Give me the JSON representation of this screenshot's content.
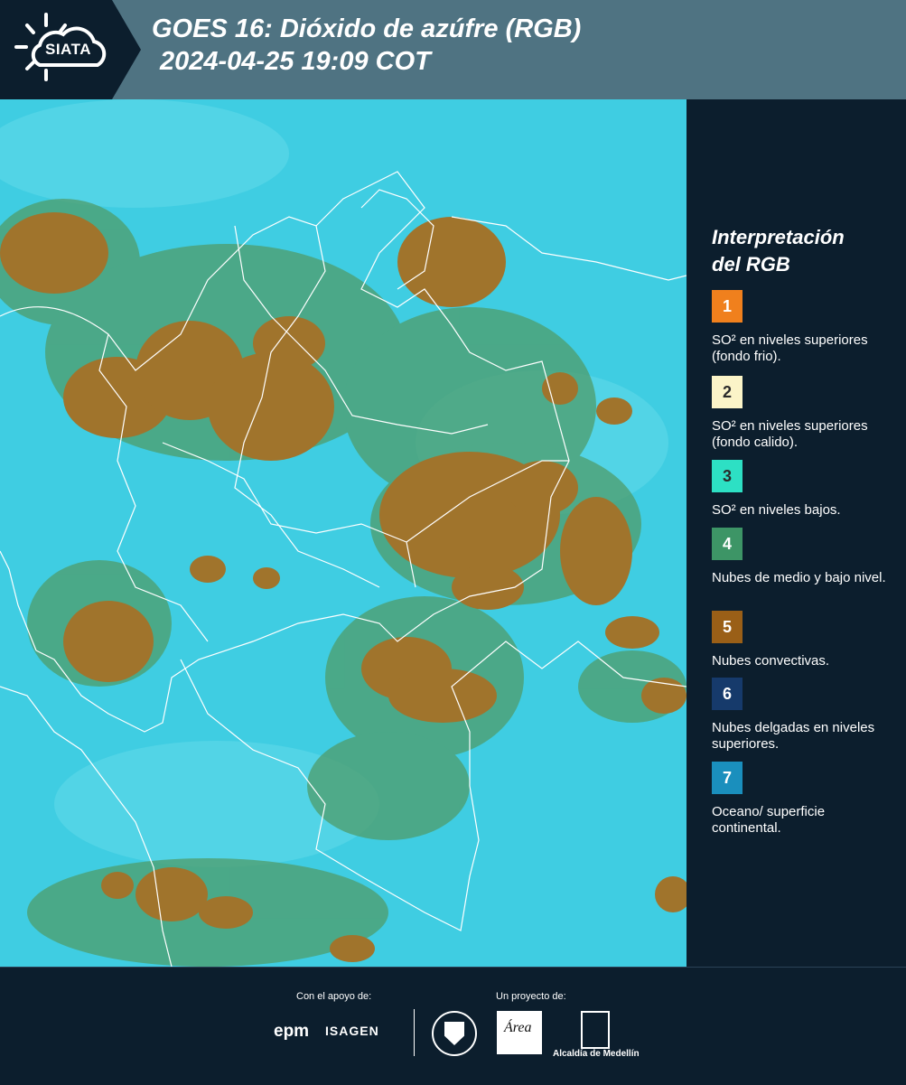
{
  "header": {
    "logo_text": "SIATA",
    "title_line1": "GOES 16: Dióxido de azúfre (RGB)",
    "title_line2": "2024-04-25 19:09 COT",
    "background_color": "#4f7382",
    "dark_color": "#0c1e2d"
  },
  "map": {
    "ocean_color": "#3fcde2",
    "convective_color": "#a0742c",
    "mid_cloud_color": "#4f9c6a",
    "border_color": "#ffffff"
  },
  "legend": {
    "title_line1": "Interpretación",
    "title_line2": "del RGB",
    "items": [
      {
        "number": "1",
        "label": "SO² en niveles superiores (fondo frio).",
        "color": "#f0801d"
      },
      {
        "number": "2",
        "label": "SO² en niveles superiores (fondo calido).",
        "color": "#fbf4c8"
      },
      {
        "number": "3",
        "label": "SO² en niveles bajos.",
        "color": "#2de0c4"
      },
      {
        "number": "4",
        "label": "Nubes de medio y bajo nivel.",
        "color": "#3d9566"
      },
      {
        "number": "5",
        "label": "Nubes convectivas.",
        "color": "#9a5f17"
      },
      {
        "number": "6",
        "label": "Nubes delgadas en niveles superiores.",
        "color": "#163a6b"
      },
      {
        "number": "7",
        "label": "Oceano/ superficie continental.",
        "color": "#1a8fbd"
      }
    ]
  },
  "footer": {
    "support_label": "Con el apoyo de:",
    "project_label": "Un proyecto de:",
    "sponsor1": "epm",
    "sponsor2": "ISAGEN",
    "partner_area": "Área",
    "partner_alcaldia": "Alcaldía de Medellín"
  }
}
